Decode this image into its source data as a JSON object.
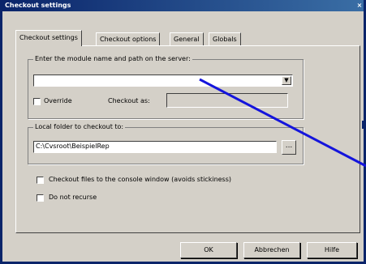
{
  "window": {
    "title": "Checkout settings",
    "close_glyph": "×"
  },
  "tabs": [
    {
      "label": "Checkout settings",
      "active": true
    },
    {
      "label": "Checkout options",
      "active": false
    },
    {
      "label": "General",
      "active": false
    },
    {
      "label": "Globals",
      "active": false
    }
  ],
  "module_group": {
    "legend": "Enter the module name and path on the server:",
    "value": "",
    "override_label": "Override",
    "override_checked": false,
    "checkout_as_label": "Checkout as:",
    "checkout_as_value": ""
  },
  "local_group": {
    "legend": "Local folder to checkout to:",
    "path": "C:\\Cvsroot\\BeispielRep",
    "browse_label": "..."
  },
  "options": [
    {
      "label": "Checkout files to the console window (avoids stickiness)",
      "checked": false
    },
    {
      "label": "Do not recurse",
      "checked": false
    }
  ],
  "footer": {
    "ok_label": "OK",
    "cancel_label": "Abbrechen",
    "help_label": "Hilfe"
  },
  "colors": {
    "title_bar": "#0a246a",
    "face": "#d4d0c8",
    "pointer": "#1414dc"
  }
}
